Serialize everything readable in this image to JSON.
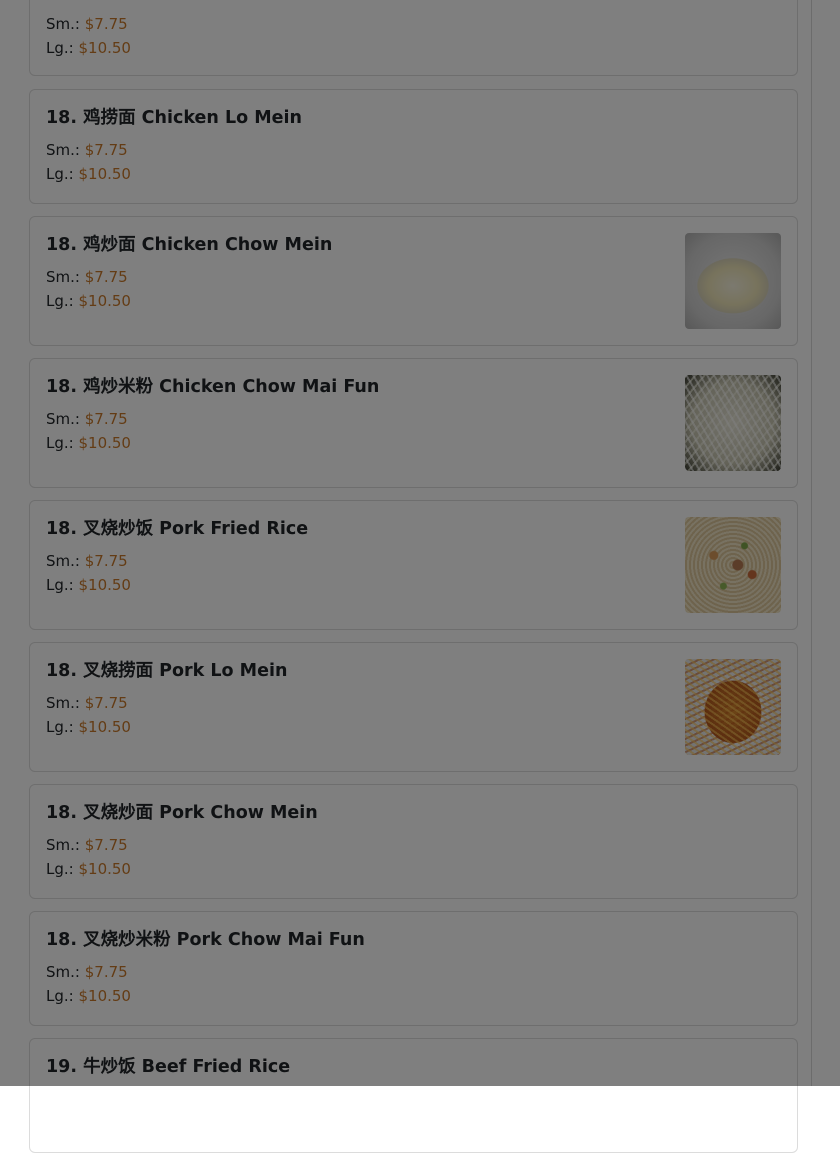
{
  "menu": {
    "items": [
      {
        "title": "",
        "sm_label": "Sm.:",
        "sm_price": "$7.75",
        "lg_label": "Lg.:",
        "lg_price": "$10.50",
        "image": null
      },
      {
        "title": "18. 鸡捞面 Chicken Lo Mein",
        "sm_label": "Sm.:",
        "sm_price": "$7.75",
        "lg_label": "Lg.:",
        "lg_price": "$10.50",
        "image": null
      },
      {
        "title": "18. 鸡炒面 Chicken Chow Mein",
        "sm_label": "Sm.:",
        "sm_price": "$7.75",
        "lg_label": "Lg.:",
        "lg_price": "$10.50",
        "image": "chow-mein-photo"
      },
      {
        "title": "18. 鸡炒米粉 Chicken Chow Mai Fun",
        "sm_label": "Sm.:",
        "sm_price": "$7.75",
        "lg_label": "Lg.:",
        "lg_price": "$10.50",
        "image": "mai-fun-photo"
      },
      {
        "title": "18. 叉烧炒饭 Pork Fried Rice",
        "sm_label": "Sm.:",
        "sm_price": "$7.75",
        "lg_label": "Lg.:",
        "lg_price": "$10.50",
        "image": "fried-rice-photo"
      },
      {
        "title": "18. 叉烧捞面 Pork Lo Mein",
        "sm_label": "Sm.:",
        "sm_price": "$7.75",
        "lg_label": "Lg.:",
        "lg_price": "$10.50",
        "image": "lo-mein-photo"
      },
      {
        "title": "18. 叉烧炒面 Pork Chow Mein",
        "sm_label": "Sm.:",
        "sm_price": "$7.75",
        "lg_label": "Lg.:",
        "lg_price": "$10.50",
        "image": null
      },
      {
        "title": "18. 叉烧炒米粉 Pork Chow Mai Fun",
        "sm_label": "Sm.:",
        "sm_price": "$7.75",
        "lg_label": "Lg.:",
        "lg_price": "$10.50",
        "image": null
      },
      {
        "title": "19. 牛炒饭 Beef Fried Rice",
        "sm_label": "",
        "sm_price": "",
        "lg_label": "",
        "lg_price": "",
        "image": null
      }
    ]
  },
  "colors": {
    "price": "#c8792a",
    "text": "#212529",
    "card_border": "#dcdcdc",
    "overlay": "rgba(0,0,0,0.5)"
  }
}
